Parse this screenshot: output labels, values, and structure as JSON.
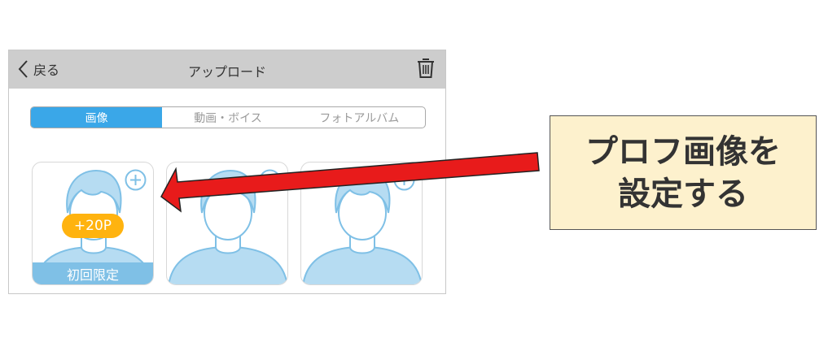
{
  "header": {
    "back_label": "戻る",
    "title": "アップロード",
    "back_icon": "chevron-left-icon",
    "delete_icon": "trash-icon"
  },
  "tabs": [
    {
      "label": "画像",
      "active": true
    },
    {
      "label": "動画・ボイス",
      "active": false
    },
    {
      "label": "フォトアルバム",
      "active": false
    }
  ],
  "cards": [
    {
      "badge": "+20P",
      "ribbon": "初回限定"
    },
    {},
    {}
  ],
  "callout": {
    "line1": "プロフ画像を",
    "line2": "設定する"
  },
  "colors": {
    "accent": "#3aa7e8",
    "avatar_fill": "#b6dcf2",
    "avatar_stroke": "#7fc0e6",
    "badge": "#ffb30f",
    "arrow": "#e81b1b",
    "callout_bg": "#fdf1cd"
  }
}
